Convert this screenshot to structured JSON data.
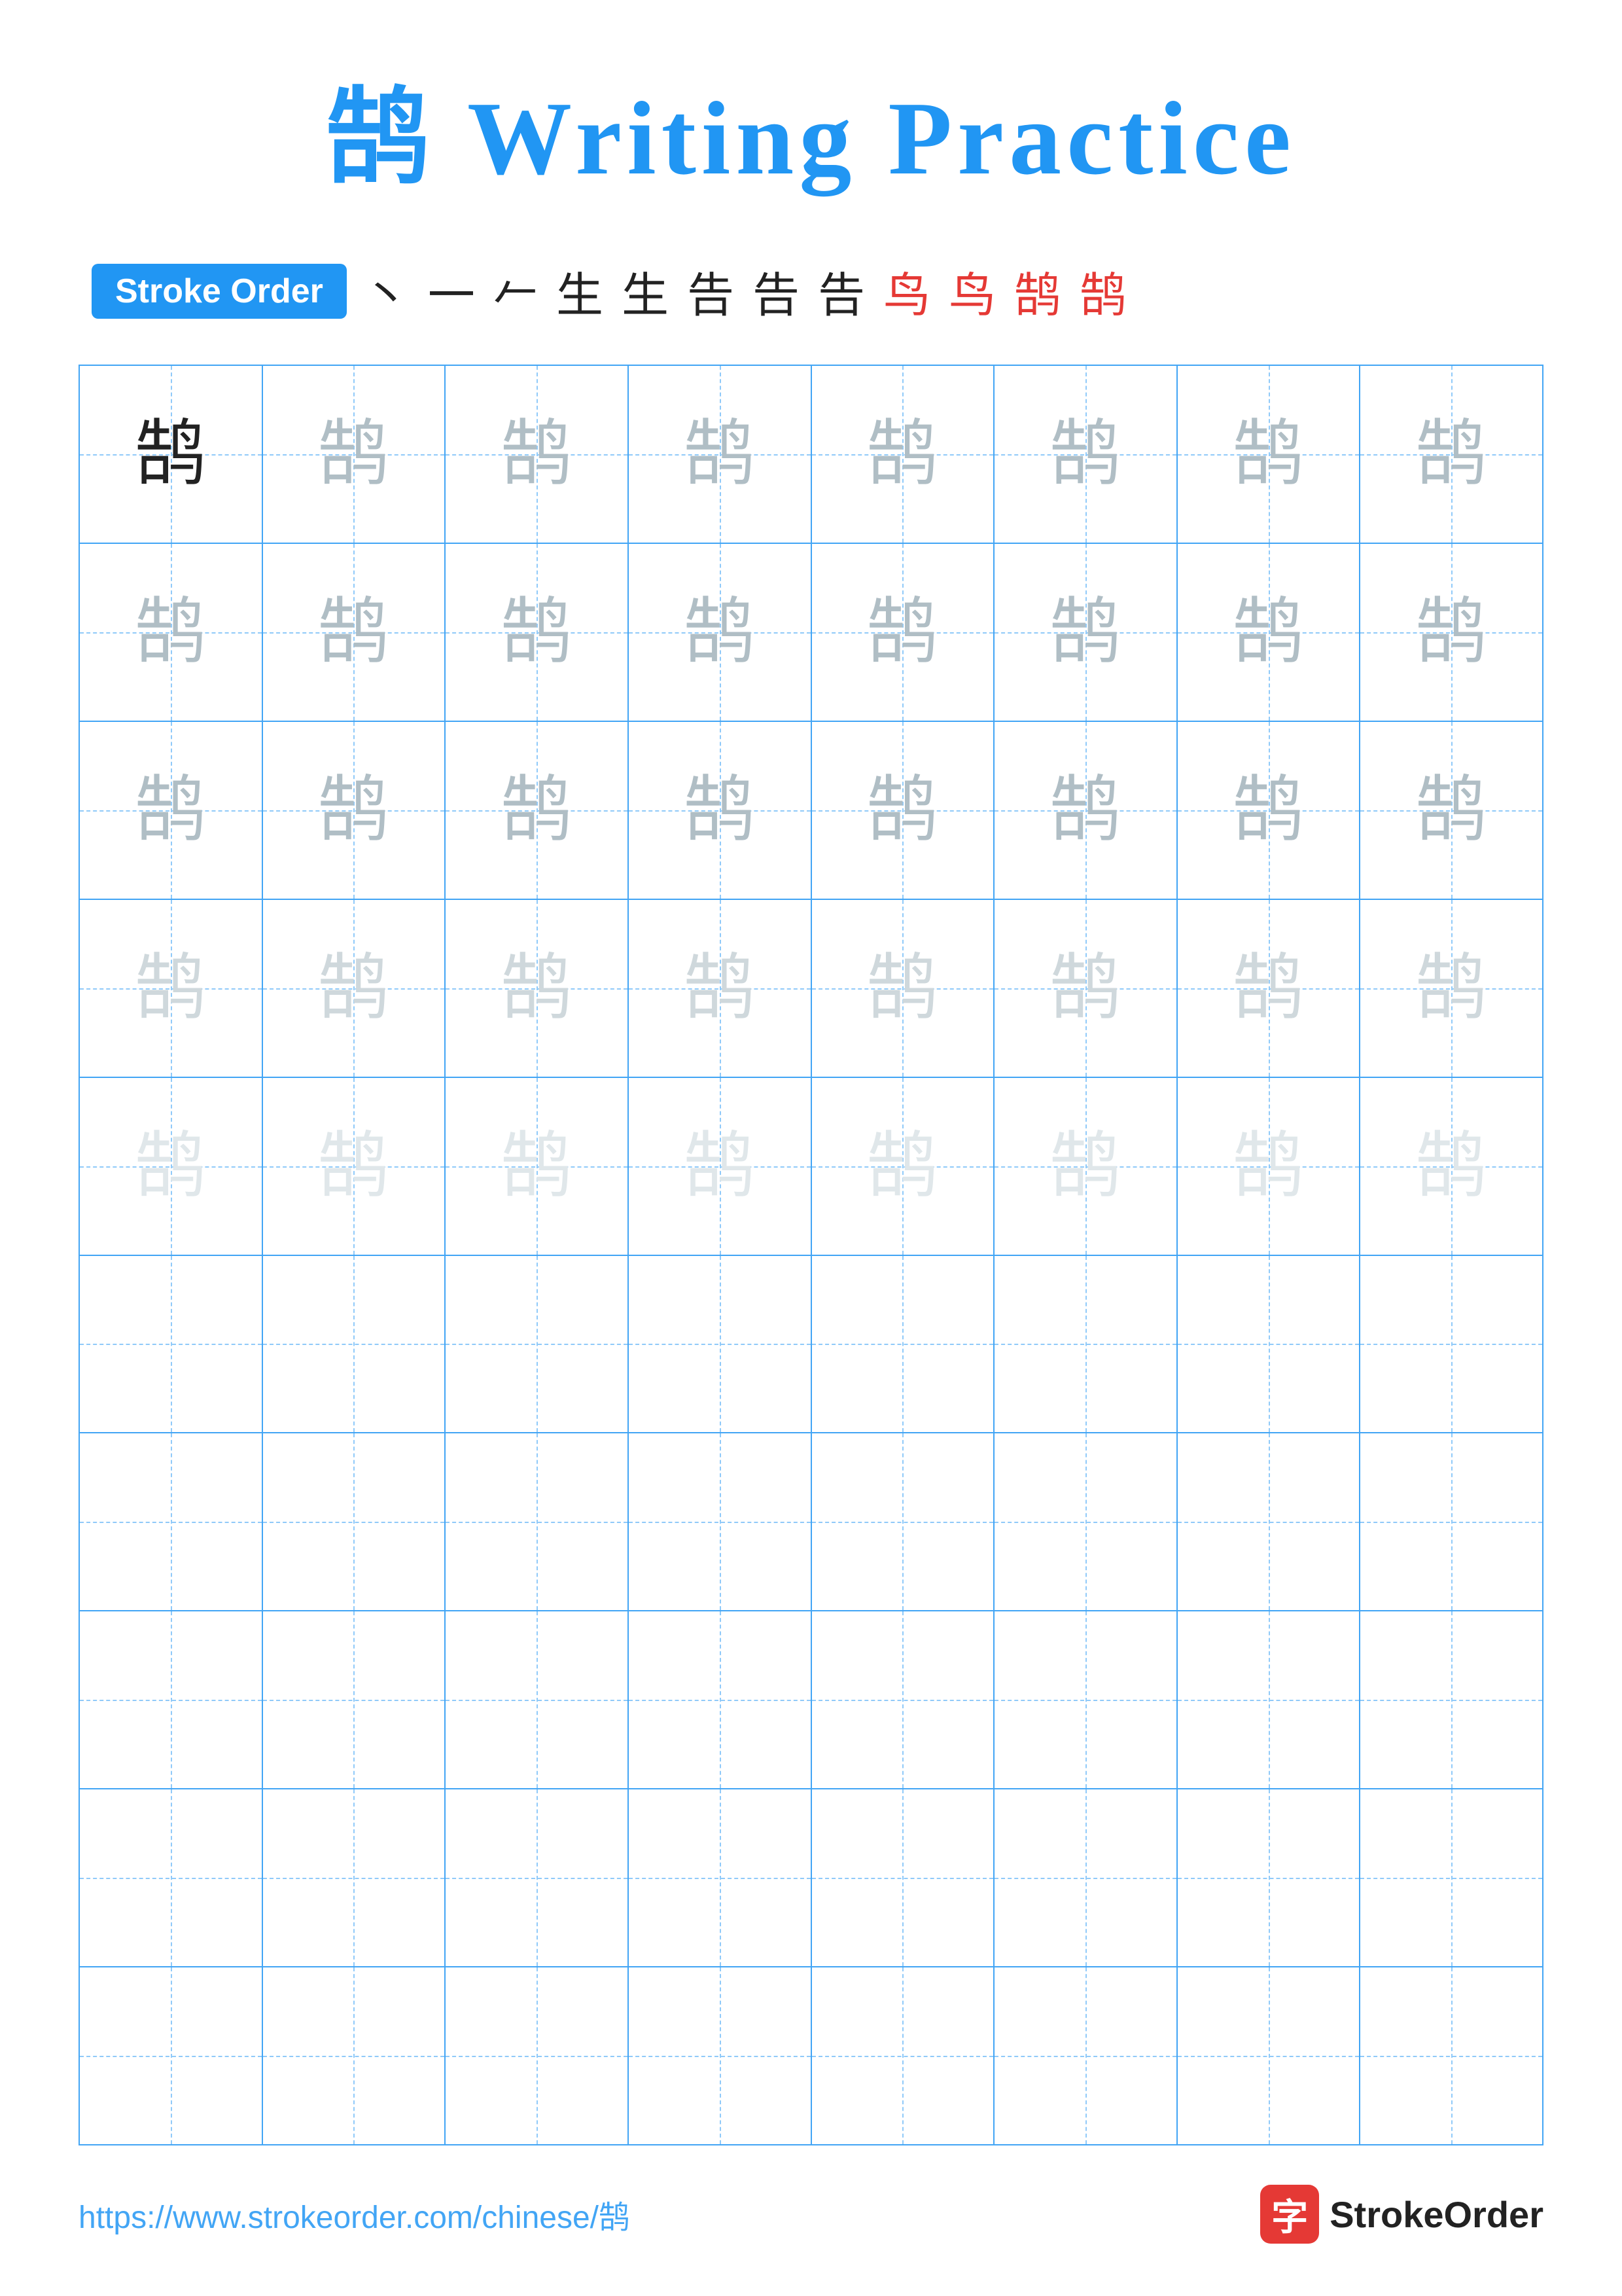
{
  "title": "鹄 Writing Practice",
  "stroke_order": {
    "badge_label": "Stroke Order",
    "strokes": [
      "丶",
      "一",
      "𠂉",
      "生",
      "生",
      "告",
      "告",
      "告",
      "鸟",
      "鸟",
      "鹄",
      "鹄"
    ]
  },
  "character": "鹄",
  "rows": [
    {
      "chars": [
        "dark",
        "medium",
        "medium",
        "medium",
        "medium",
        "medium",
        "medium",
        "medium"
      ]
    },
    {
      "chars": [
        "medium",
        "medium",
        "medium",
        "medium",
        "medium",
        "medium",
        "medium",
        "medium"
      ]
    },
    {
      "chars": [
        "medium",
        "medium",
        "medium",
        "medium",
        "medium",
        "medium",
        "medium",
        "medium"
      ]
    },
    {
      "chars": [
        "light",
        "light",
        "light",
        "light",
        "light",
        "light",
        "light",
        "light"
      ]
    },
    {
      "chars": [
        "xlight",
        "xlight",
        "xlight",
        "xlight",
        "xlight",
        "xlight",
        "xlight",
        "xlight"
      ]
    },
    {
      "chars": [
        "empty",
        "empty",
        "empty",
        "empty",
        "empty",
        "empty",
        "empty",
        "empty"
      ]
    },
    {
      "chars": [
        "empty",
        "empty",
        "empty",
        "empty",
        "empty",
        "empty",
        "empty",
        "empty"
      ]
    },
    {
      "chars": [
        "empty",
        "empty",
        "empty",
        "empty",
        "empty",
        "empty",
        "empty",
        "empty"
      ]
    },
    {
      "chars": [
        "empty",
        "empty",
        "empty",
        "empty",
        "empty",
        "empty",
        "empty",
        "empty"
      ]
    },
    {
      "chars": [
        "empty",
        "empty",
        "empty",
        "empty",
        "empty",
        "empty",
        "empty",
        "empty"
      ]
    }
  ],
  "footer": {
    "url": "https://www.strokeorder.com/chinese/鹄",
    "brand_icon": "字",
    "brand_name": "StrokeOrder"
  }
}
